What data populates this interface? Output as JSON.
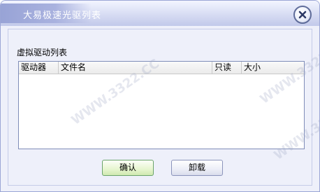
{
  "window": {
    "title": "大易极速光驱列表"
  },
  "body": {
    "group_label": "虚拟驱动列表",
    "columns": [
      "驱动器",
      "文件名",
      "只读",
      "大小"
    ],
    "rows": []
  },
  "buttons": {
    "ok_label": "确认",
    "unload_label": "卸载"
  },
  "icons": {
    "close": "close-icon"
  },
  "watermark": {
    "text": "WWW.3322.CC"
  },
  "colors": {
    "title_plate": "#a3acdc",
    "dialog_bg": "#eef0fa",
    "ok_button": "#e6f5cf"
  }
}
